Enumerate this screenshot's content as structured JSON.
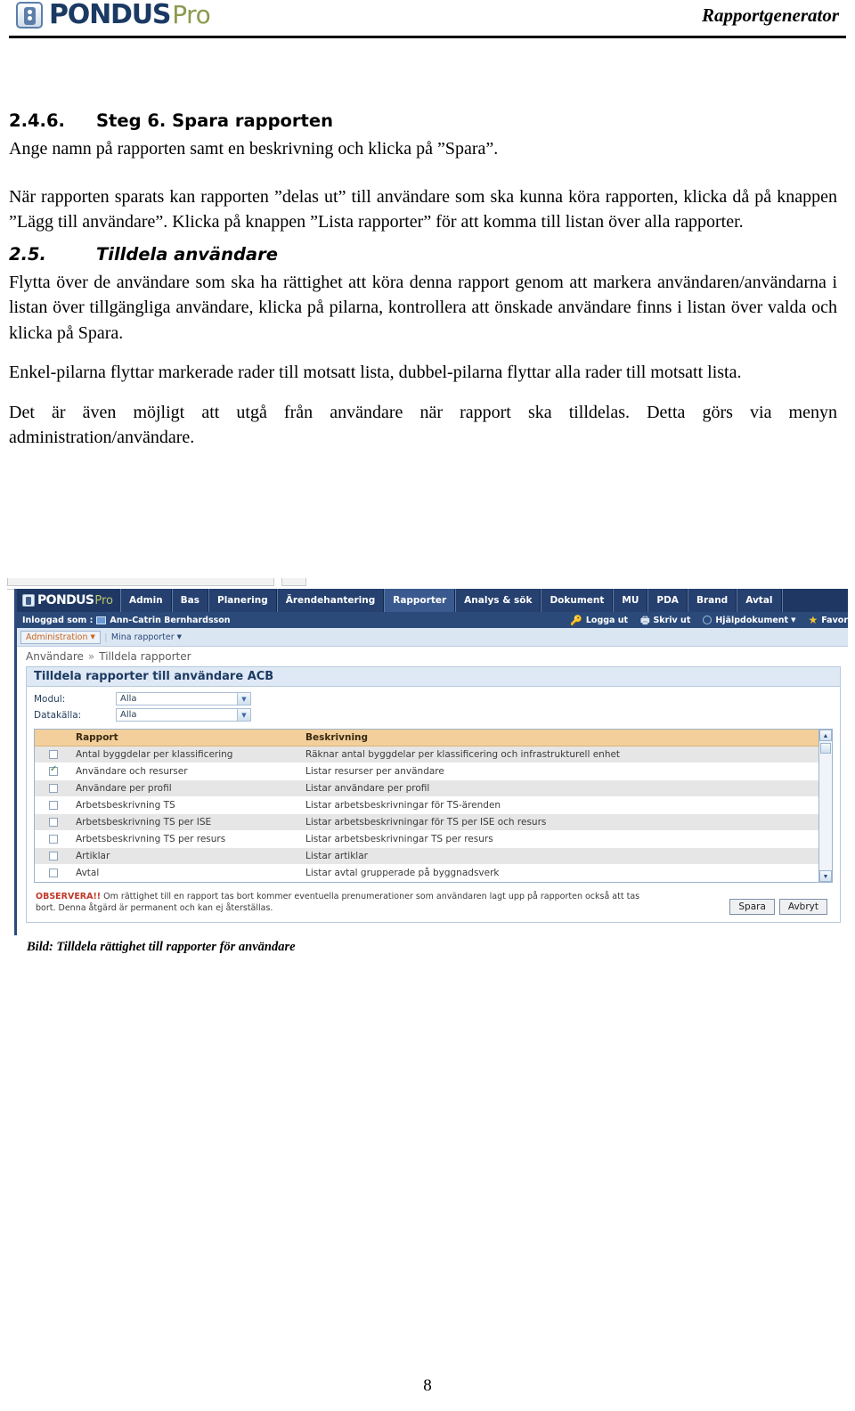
{
  "header": {
    "logo_main": "PONDUS",
    "logo_sub": "Pro",
    "title": "Rapportgenerator"
  },
  "document": {
    "section_246": {
      "number": "2.4.6.",
      "title": "Steg 6. Spara rapporten",
      "p1": "Ange namn på rapporten samt en beskrivning och klicka på ”Spara”.",
      "p2": "När rapporten sparats kan rapporten ”delas ut” till användare som ska kunna köra rapporten, klicka då på knappen ”Lägg till användare”. Klicka på knappen ”Lista rapporter” för att komma till listan över alla rapporter."
    },
    "section_25": {
      "number": "2.5.",
      "title": "Tilldela användare",
      "p1": "Flytta över de användare som ska ha rättighet att köra denna rapport genom att markera användaren/användarna i listan över tillgängliga användare, klicka på pilarna, kontrollera att önskade användare finns i listan över valda och klicka på Spara.",
      "p2": "Enkel-pilarna flyttar markerade rader till motsatt lista, dubbel-pilarna flyttar alla rader till motsatt lista.",
      "p3": "Det är även möjligt att utgå från användare när rapport ska tilldelas. Detta görs via menyn administration/användare."
    },
    "figure_caption": "Bild: Tilldela rättighet till rapporter för användare",
    "page_number": "8"
  },
  "app": {
    "logo_main": "PONDUS",
    "logo_sub": "Pro",
    "nav_tabs": [
      {
        "label": "Admin",
        "active": false
      },
      {
        "label": "Bas",
        "active": false
      },
      {
        "label": "Planering",
        "active": false
      },
      {
        "label": "Ärendehantering",
        "active": false
      },
      {
        "label": "Rapporter",
        "active": true
      },
      {
        "label": "Analys & sök",
        "active": false
      },
      {
        "label": "Dokument",
        "active": false
      },
      {
        "label": "MU",
        "active": false
      },
      {
        "label": "PDA",
        "active": false
      },
      {
        "label": "Brand",
        "active": false
      },
      {
        "label": "Avtal",
        "active": false
      }
    ],
    "user_bar": {
      "logged_in_label": "Inloggad som :",
      "user_name": "Ann-Catrin Bernhardsson",
      "actions": [
        {
          "label": "Logga ut",
          "icon": "key-icon"
        },
        {
          "label": "Skriv ut",
          "icon": "printer-icon"
        },
        {
          "label": "Hjälpdokument",
          "icon": "help-icon",
          "caret": "▼"
        },
        {
          "label": "Favor",
          "icon": "star-icon"
        }
      ]
    },
    "menu_bar": {
      "primary": "Administration",
      "primary_caret": "▼",
      "separator": "|",
      "secondary": "Mina rapporter",
      "secondary_caret": "▼"
    },
    "breadcrumb": {
      "root": "Användare",
      "separator": "»",
      "current": "Tilldela rapporter"
    },
    "panel": {
      "title": "Tilldela rapporter till användare ACB",
      "fields": [
        {
          "label": "Modul:",
          "value": "Alla"
        },
        {
          "label": "Datakälla:",
          "value": "Alla"
        }
      ],
      "table": {
        "columns": [
          "",
          "Rapport",
          "Beskrivning"
        ],
        "rows": [
          {
            "checked": false,
            "rapport": "Antal byggdelar per klassificering",
            "beskrivning": "Räknar antal byggdelar per klassificering och infrastrukturell enhet"
          },
          {
            "checked": true,
            "rapport": "Användare och resurser",
            "beskrivning": "Listar resurser per användare"
          },
          {
            "checked": false,
            "rapport": "Användare per profil",
            "beskrivning": "Listar användare per profil"
          },
          {
            "checked": false,
            "rapport": "Arbetsbeskrivning TS",
            "beskrivning": "Listar arbetsbeskrivningar för TS-ärenden"
          },
          {
            "checked": false,
            "rapport": "Arbetsbeskrivning TS per ISE",
            "beskrivning": "Listar arbetsbeskrivningar för TS per ISE och resurs"
          },
          {
            "checked": false,
            "rapport": "Arbetsbeskrivning TS per resurs",
            "beskrivning": "Listar arbetsbeskrivningar TS per resurs"
          },
          {
            "checked": false,
            "rapport": "Artiklar",
            "beskrivning": "Listar artiklar"
          },
          {
            "checked": false,
            "rapport": "Avtal",
            "beskrivning": "Listar avtal grupperade på byggnadsverk"
          }
        ]
      },
      "notice_prefix": "OBSERVERA!!",
      "notice_text": " Om rättighet till en rapport tas bort kommer eventuella prenumerationer som användaren lagt upp på rapporten också att tas bort. Denna åtgärd är permanent och kan ej återställas.",
      "save_button": "Spara",
      "cancel_button": "Avbryt"
    }
  },
  "colors": {
    "brand_dark_blue": "#1f3763",
    "brand_olive": "#8a9a4e",
    "nav_active": "#3a5a8f",
    "table_header": "#f2cf9b",
    "notice_red": "#c0392b",
    "menu_orange": "#c8651d"
  }
}
